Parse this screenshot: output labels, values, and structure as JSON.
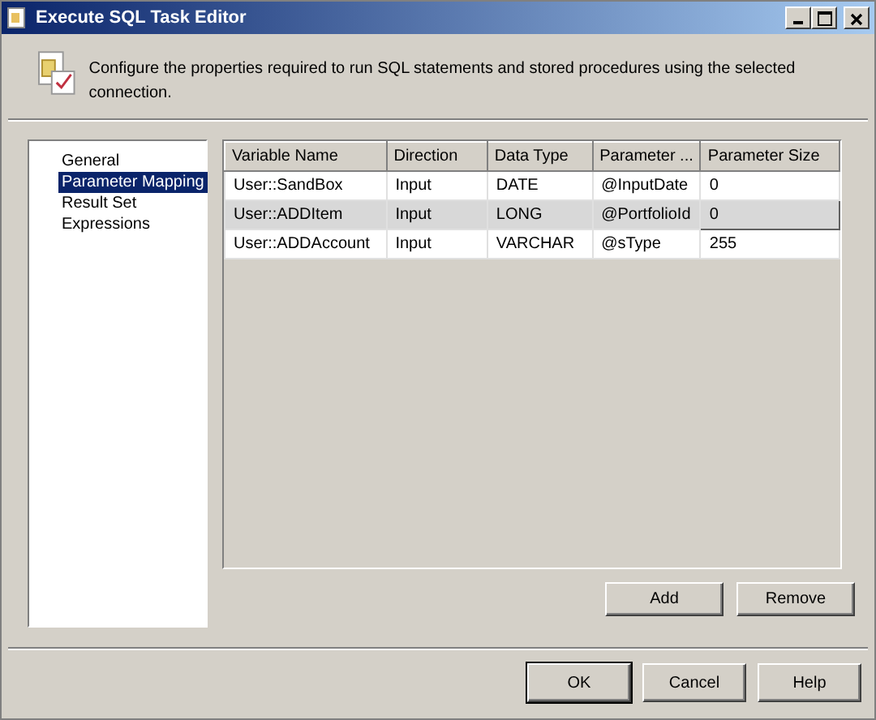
{
  "window": {
    "title": "Execute SQL Task Editor"
  },
  "header": {
    "description": "Configure the properties required to run SQL statements and stored procedures using the selected connection."
  },
  "sidebar": {
    "items": [
      {
        "label": "General",
        "selected": false
      },
      {
        "label": "Parameter Mapping",
        "selected": true
      },
      {
        "label": "Result Set",
        "selected": false
      },
      {
        "label": "Expressions",
        "selected": false
      }
    ]
  },
  "table": {
    "columns": [
      "Variable Name",
      "Direction",
      "Data Type",
      "Parameter ...",
      "Parameter Size"
    ],
    "rows": [
      {
        "cells": [
          "User::SandBox",
          "Input",
          "DATE",
          "@InputDate",
          "0"
        ],
        "selected": false
      },
      {
        "cells": [
          "User::ADDItem",
          "Input",
          "LONG",
          "@PortfolioId",
          "0"
        ],
        "selected": true
      },
      {
        "cells": [
          "User::ADDAccount",
          "Input",
          "VARCHAR",
          "@sType",
          "255"
        ],
        "selected": false
      }
    ]
  },
  "table_buttons": [
    "Add",
    "Remove"
  ],
  "dialog_buttons": [
    "OK",
    "Cancel",
    "Help"
  ]
}
